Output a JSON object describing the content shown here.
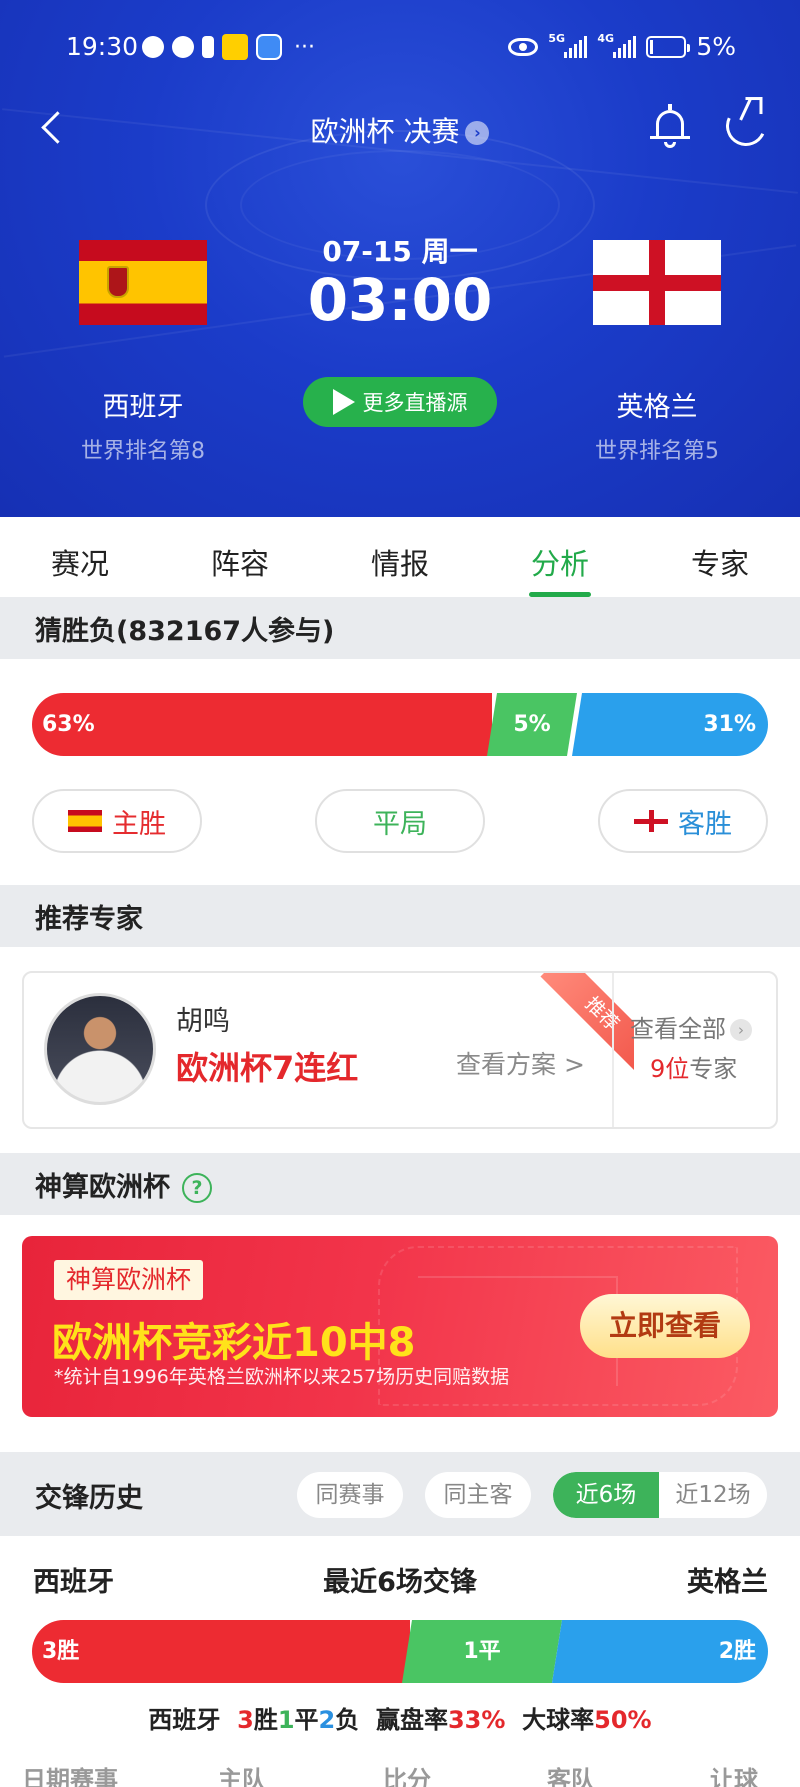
{
  "status_bar": {
    "time": "19:30",
    "battery": "5%",
    "network1": "5G",
    "network2": "4G"
  },
  "header": {
    "title": "欧洲杯 决赛",
    "date": "07-15 周一",
    "time": "03:00",
    "home": {
      "name": "西班牙",
      "rank": "世界排名第8"
    },
    "away": {
      "name": "英格兰",
      "rank": "世界排名第5"
    },
    "live_button": "更多直播源"
  },
  "tabs": [
    {
      "label": "赛况"
    },
    {
      "label": "阵容"
    },
    {
      "label": "情报"
    },
    {
      "label": "分析",
      "active": true
    },
    {
      "label": "专家"
    }
  ],
  "guess": {
    "title": "猜胜负(832167人参与)",
    "home_pct": "63%",
    "draw_pct": "5%",
    "away_pct": "31%",
    "home_btn": "主胜",
    "draw_btn": "平局",
    "away_btn": "客胜"
  },
  "experts": {
    "title": "推荐专家",
    "name": "胡鸣",
    "record": "欧洲杯7连红",
    "ribbon": "推荐",
    "view_plan": "查看方案 >",
    "view_all": "查看全部",
    "count_num": "9位",
    "count_text": "专家"
  },
  "shensuan": {
    "title": "神算欧洲杯",
    "help": "?",
    "tag": "神算欧洲杯",
    "headline": "欧洲杯竞彩近10中8",
    "note": "*统计自1996年英格兰欧洲杯以来257场历史同赔数据",
    "button": "立即查看"
  },
  "history": {
    "title": "交锋历史",
    "filters": [
      "同赛事",
      "同主客",
      "近6场",
      "近12场"
    ],
    "home": "西班牙",
    "middle": "最近6场交锋",
    "away": "英格兰",
    "win": "3胜",
    "draw": "1平",
    "lose": "2胜",
    "summary": {
      "team": "西班牙",
      "w": "3",
      "w_l": "胜",
      "d": "1",
      "d_l": "平",
      "l": "2",
      "l_l": "负",
      "rate_label": "赢盘率",
      "rate": "33%",
      "big_label": "大球率",
      "big": "50%"
    },
    "columns": [
      "日期赛事",
      "主队",
      "比分",
      "客队",
      "让球"
    ]
  },
  "colors": {
    "brand_blue": "#1b3cc9",
    "green": "#22aa4a",
    "red": "#ed2b32",
    "blue": "#2aa0ec"
  }
}
